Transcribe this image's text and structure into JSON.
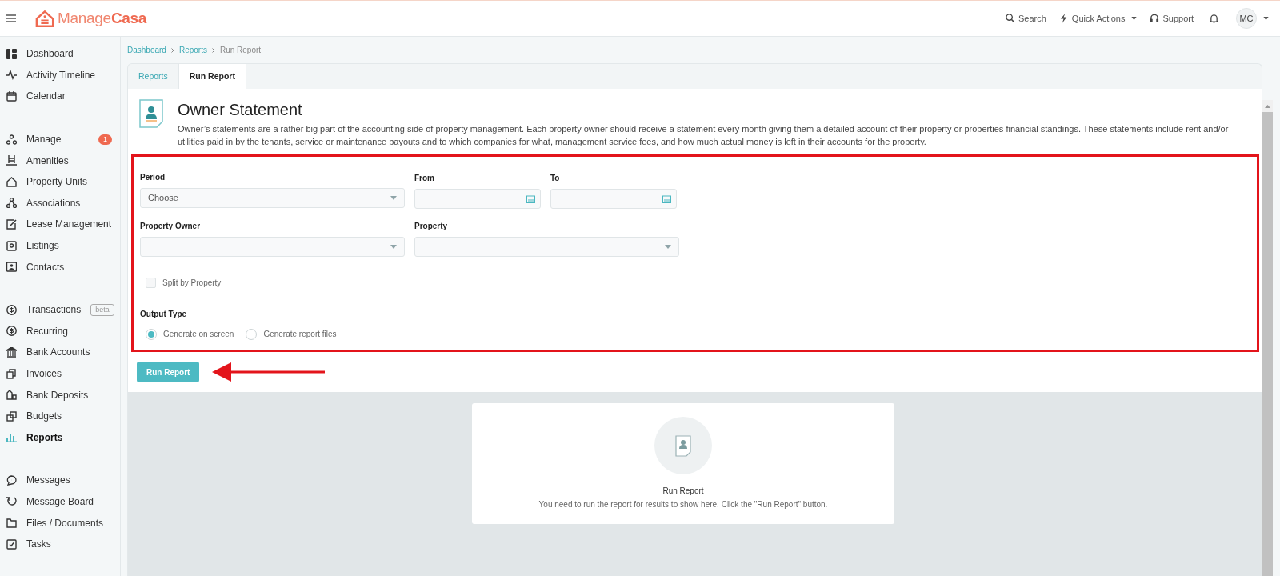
{
  "header": {
    "logo": {
      "part1": "Manage",
      "part2": "Casa"
    },
    "actions": [
      {
        "kind": "search",
        "label": "Search",
        "dropdown": false
      },
      {
        "kind": "bolt",
        "label": "Quick Actions",
        "dropdown": true
      },
      {
        "kind": "headset",
        "label": "Support",
        "dropdown": false
      }
    ],
    "avatar": "MC"
  },
  "sidebar": {
    "groups": [
      [
        {
          "label": "Dashboard",
          "selected": false
        },
        {
          "label": "Activity Timeline",
          "selected": false
        },
        {
          "label": "Calendar",
          "selected": false
        }
      ],
      [
        {
          "label": "Manage",
          "selected": false,
          "badge": "1"
        },
        {
          "label": "Amenities",
          "selected": false
        },
        {
          "label": "Property Units",
          "selected": false
        },
        {
          "label": "Associations",
          "selected": false
        },
        {
          "label": "Lease Management",
          "selected": false
        },
        {
          "label": "Listings",
          "selected": false
        },
        {
          "label": "Contacts",
          "selected": false
        }
      ],
      [
        {
          "label": "Transactions",
          "selected": false,
          "tag": "beta"
        },
        {
          "label": "Recurring",
          "selected": false
        },
        {
          "label": "Bank Accounts",
          "selected": false
        },
        {
          "label": "Invoices",
          "selected": false
        },
        {
          "label": "Bank Deposits",
          "selected": false
        },
        {
          "label": "Budgets",
          "selected": false
        },
        {
          "label": "Reports",
          "selected": true
        }
      ],
      [
        {
          "label": "Messages",
          "selected": false
        },
        {
          "label": "Message Board",
          "selected": false
        },
        {
          "label": "Files / Documents",
          "selected": false
        },
        {
          "label": "Tasks",
          "selected": false
        }
      ]
    ]
  },
  "breadcrumb": [
    {
      "label": "Dashboard",
      "link": true
    },
    {
      "label": "Reports",
      "link": true
    },
    {
      "label": "Run Report",
      "link": false
    }
  ],
  "tabs": [
    {
      "label": "Reports",
      "selected": false
    },
    {
      "label": "Run Report",
      "selected": true
    }
  ],
  "report": {
    "title": "Owner Statement",
    "description": "Owner’s statements are a rather big part of the accounting side of property management. Each property owner should receive a statement every month giving them a detailed account of their property or properties financial standings. These statements include rent and/or utilities paid in by the tenants, service or maintenance payouts and to which companies for what, management service fees, and how much actual money is left in their accounts for the property."
  },
  "form": {
    "period": {
      "label": "Period",
      "value": "Choose"
    },
    "from": {
      "label": "From"
    },
    "to": {
      "label": "To"
    },
    "property_owner": {
      "label": "Property Owner"
    },
    "property": {
      "label": "Property"
    },
    "split_by_property": {
      "label": "Split by Property",
      "checked": false
    },
    "output_type": {
      "label": "Output Type",
      "options": [
        {
          "label": "Generate on screen",
          "selected": true
        },
        {
          "label": "Generate report files",
          "selected": false
        }
      ]
    },
    "run_button": "Run Report"
  },
  "results": {
    "title": "Run Report",
    "message": "You need to run the report for results to show here. Click the \"Run Report\" button."
  }
}
